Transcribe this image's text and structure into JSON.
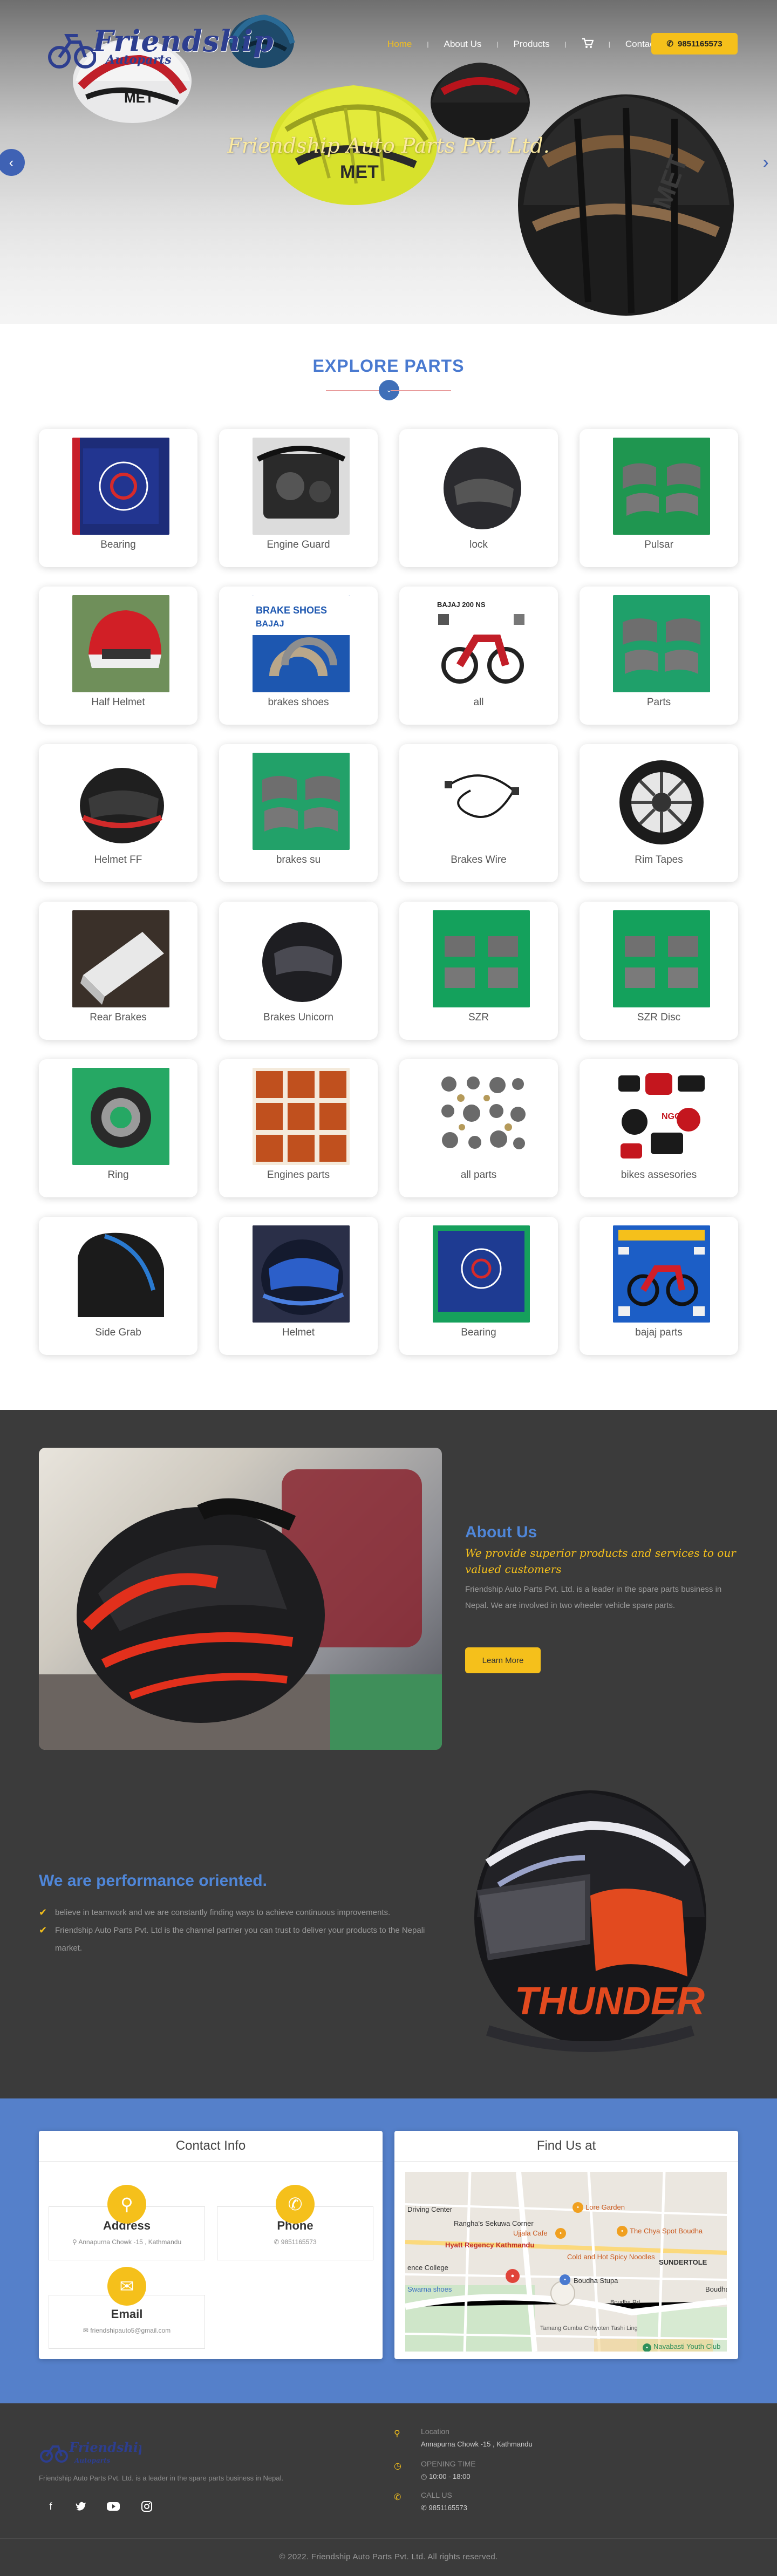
{
  "brand": {
    "logo_text": "Friendship",
    "logo_sub": "Autoparts",
    "hero_title": "Friendship Auto Parts Pvt. Ltd."
  },
  "nav": {
    "items": [
      {
        "label": "Home"
      },
      {
        "label": "About Us"
      },
      {
        "label": "Products"
      }
    ],
    "contact_label": "Contact",
    "phone": "9851165573",
    "cart_icon": "cart-icon"
  },
  "explore": {
    "title": "EXPLORE PARTS",
    "products": [
      {
        "label": "Bearing"
      },
      {
        "label": "Engine Guard"
      },
      {
        "label": "lock"
      },
      {
        "label": "Pulsar"
      },
      {
        "label": "Half Helmet"
      },
      {
        "label": "brakes shoes",
        "image_text_1": "BRAKE SHOES",
        "image_text_2": "BAJAJ"
      },
      {
        "label": "all",
        "image_text_1": "BAJAJ 200 NS"
      },
      {
        "label": "Parts"
      },
      {
        "label": "Helmet FF"
      },
      {
        "label": "brakes su"
      },
      {
        "label": "Brakes Wire"
      },
      {
        "label": "Rim Tapes"
      },
      {
        "label": "Rear Brakes"
      },
      {
        "label": "Brakes Unicorn"
      },
      {
        "label": "SZR"
      },
      {
        "label": "SZR Disc"
      },
      {
        "label": "Ring"
      },
      {
        "label": "Engines parts"
      },
      {
        "label": "all parts"
      },
      {
        "label": "bikes assesories"
      },
      {
        "label": "Side Grab"
      },
      {
        "label": "Helmet"
      },
      {
        "label": "Bearing"
      },
      {
        "label": "bajaj parts"
      }
    ]
  },
  "about": {
    "heading": "About Us",
    "tagline": "We provide superior products and services to our valued customers",
    "text": "Friendship Auto Parts Pvt. Ltd. is a leader in the spare parts business in Nepal. We are involved in two wheeler vehicle spare parts.",
    "button": "Learn More",
    "perf_heading": "We are performance oriented.",
    "perf_points": [
      "believe in teamwork and we are constantly finding ways to achieve continuous improvements.",
      "Friendship Auto Parts Pvt. Ltd is the channel partner you can trust to deliver your products to the Nepali market."
    ]
  },
  "contact": {
    "title": "Contact Info",
    "address_title": "Address",
    "address": "Annapurna Chowk -15 , Kathmandu",
    "phone_title": "Phone",
    "phone": "9851165573",
    "email_title": "Email",
    "email": "friendshipauto5@gmail.com",
    "map_title": "Find Us at",
    "map_labels": [
      "Driving Center",
      "Rangha's Sekuwa Corner",
      "Lore Garden",
      "Ujjala Cafe",
      "The Chya Spot Boudha",
      "Hyatt Regency Kathmandu",
      "Cold and Hot Spicy Noodles",
      "SUNDERTOLE",
      "Boudha Stupa",
      "Swarna shoes",
      "Boudha Rd",
      "Tamang Gumba Chhyoten Tashi Ling",
      "Navabasti Youth Club",
      "Boudha",
      "ence College"
    ]
  },
  "footer": {
    "about": "Friendship Auto Parts Pvt. Ltd. is a leader in the spare parts business in Nepal.",
    "location_label": "Location",
    "location": "Annapurna Chowk -15 , Kathmandu",
    "hours_label": "OPENING TIME",
    "hours": "10:00 - 18:00",
    "call_label": "CALL US",
    "call": "9851165573",
    "copyright": "© 2022. Friendship Auto Parts Pvt. Ltd. All rights reserved.",
    "social": [
      "facebook-icon",
      "twitter-icon",
      "youtube-icon",
      "instagram-icon"
    ]
  },
  "colors": {
    "accent": "#f5c01b",
    "blue": "#4f86d8",
    "contact_bg": "#5580ca",
    "dark_bg": "#3b3b3b"
  }
}
